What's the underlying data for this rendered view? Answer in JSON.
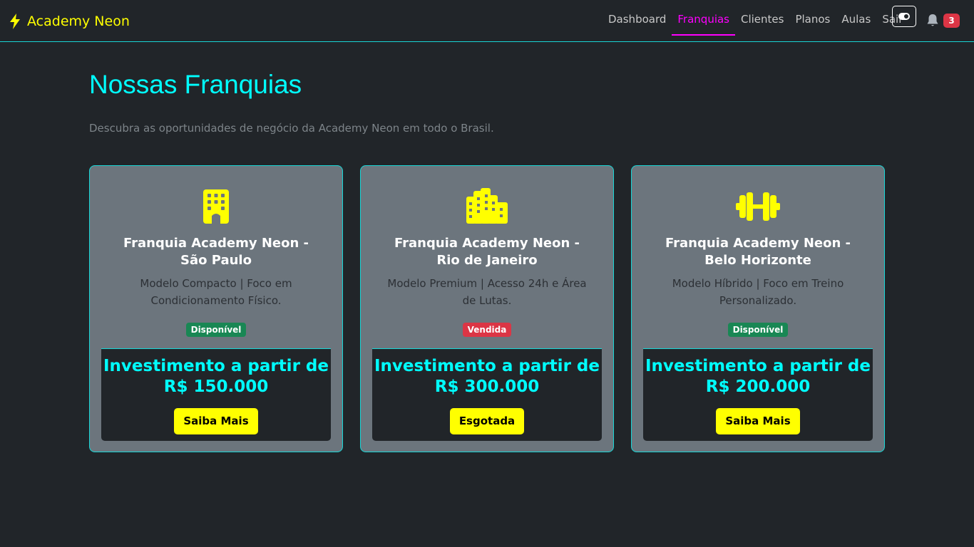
{
  "navbar": {
    "brand": "Academy Neon",
    "links": [
      "Dashboard",
      "Franquias",
      "Clientes",
      "Planos",
      "Aulas",
      "Sair"
    ],
    "notification_count": "3"
  },
  "page": {
    "title": "Nossas Franquias",
    "subtitle": "Descubra as oportunidades de negócio da Academy Neon em todo o Brasil."
  },
  "cards": [
    {
      "icon": "building-icon",
      "title": "Franquia Academy Neon - São Paulo",
      "description": "Modelo Compacto | Foco em Condicionamento Físico.",
      "status": "Disponível",
      "investment": "Investimento a partir de R$ 150.000",
      "button": "Saiba Mais"
    },
    {
      "icon": "industry-icon",
      "title": "Franquia Academy Neon - Rio de Janeiro",
      "description": "Modelo Premium | Acesso 24h e Área de Lutas.",
      "status": "Vendida",
      "investment": "Investimento a partir de R$ 300.000",
      "button": "Esgotada"
    },
    {
      "icon": "dumbbell-icon",
      "title": "Franquia Academy Neon - Belo Horizonte",
      "description": "Modelo Híbrido | Foco em Treino Personalizado.",
      "status": "Disponível",
      "investment": "Investimento a partir de R$ 200.000",
      "button": "Saiba Mais"
    }
  ],
  "colors": {
    "background": "#212529",
    "card": "#6c757d",
    "accent_cyan": "#00ffff",
    "accent_magenta": "#ff00ff",
    "accent_yellow": "#ffff00",
    "success": "#198754",
    "danger": "#dc3545"
  }
}
